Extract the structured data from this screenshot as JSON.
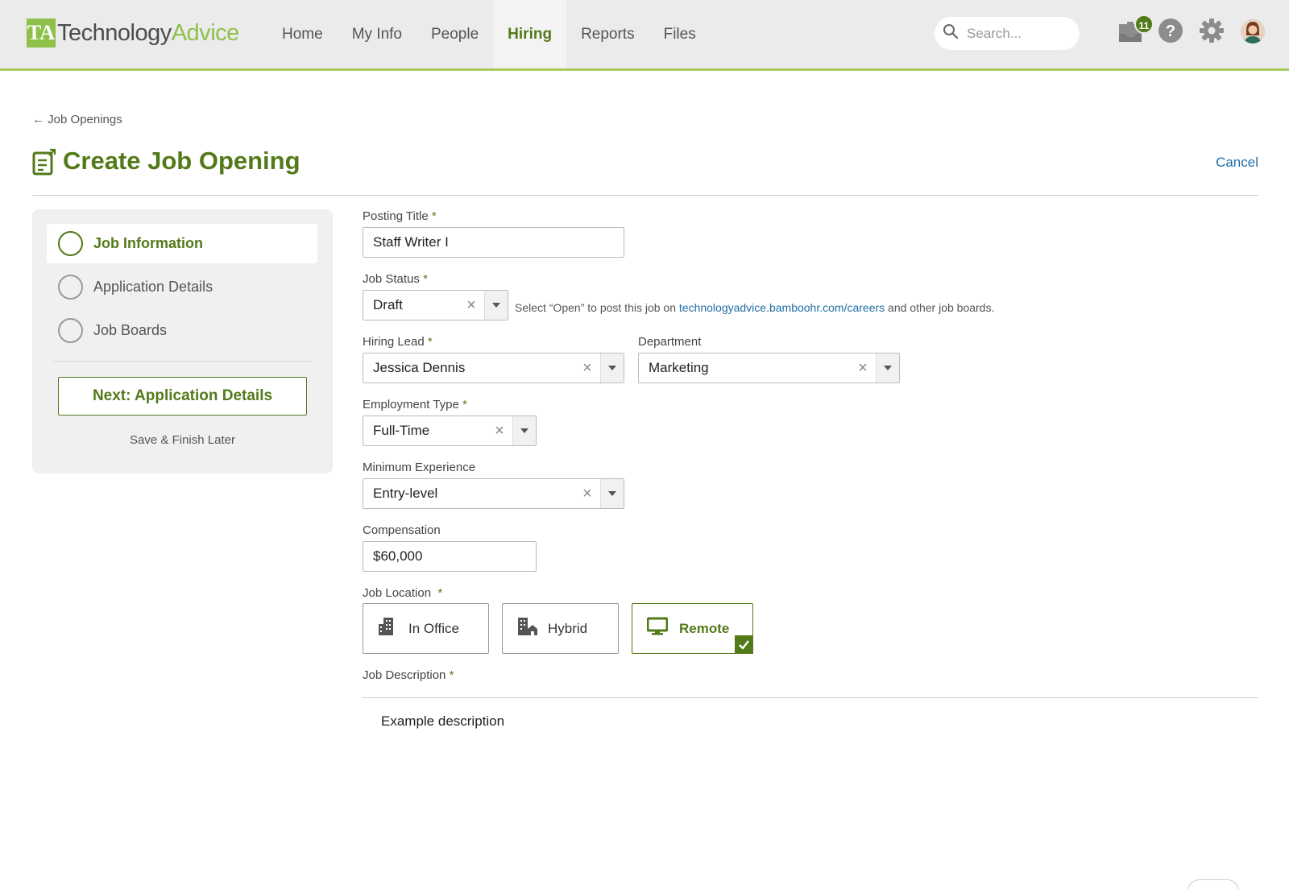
{
  "brand": {
    "mark": "TA",
    "name_part1": "Technology",
    "name_part2": "Advice"
  },
  "nav": {
    "items": [
      {
        "label": "Home"
      },
      {
        "label": "My Info"
      },
      {
        "label": "People"
      },
      {
        "label": "Hiring",
        "active": true
      },
      {
        "label": "Reports"
      },
      {
        "label": "Files"
      }
    ]
  },
  "header": {
    "search_placeholder": "Search...",
    "inbox_count": "11",
    "icons": [
      "inbox-icon",
      "help-icon",
      "gear-icon",
      "avatar"
    ]
  },
  "page": {
    "breadcrumb": "Job Openings",
    "title": "Create Job Opening",
    "cancel_label": "Cancel"
  },
  "steps": {
    "items": [
      {
        "label": "Job Information",
        "active": true
      },
      {
        "label": "Application Details",
        "active": false
      },
      {
        "label": "Job Boards",
        "active": false
      }
    ],
    "next_label": "Next: Application Details",
    "save_later_label": "Save & Finish Later"
  },
  "form": {
    "posting_title": {
      "label": "Posting Title",
      "value": "Staff Writer I"
    },
    "job_status": {
      "label": "Job Status",
      "value": "Draft",
      "hint_prefix": "Select “Open” to post this job on ",
      "hint_link": "technologyadvice.bamboohr.com/careers",
      "hint_suffix": " and other job boards."
    },
    "hiring_lead": {
      "label": "Hiring Lead",
      "value": "Jessica Dennis"
    },
    "department": {
      "label": "Department",
      "value": "Marketing"
    },
    "employment_type": {
      "label": "Employment Type",
      "value": "Full-Time"
    },
    "minimum_experience": {
      "label": "Minimum Experience",
      "value": "Entry-level"
    },
    "compensation": {
      "label": "Compensation",
      "value": "$60,000"
    },
    "job_location": {
      "label": "Job Location",
      "options": [
        {
          "label": "In Office",
          "icon": "building-icon"
        },
        {
          "label": "Hybrid",
          "icon": "hybrid-building-icon"
        },
        {
          "label": "Remote",
          "icon": "monitor-icon",
          "selected": true
        }
      ]
    },
    "job_description": {
      "label": "Job Description",
      "value": "Example description"
    },
    "required_mark": "*"
  },
  "colors": {
    "brand_green": "#527a19",
    "accent_green": "#8fc04a",
    "link_blue": "#1f6ea5"
  }
}
